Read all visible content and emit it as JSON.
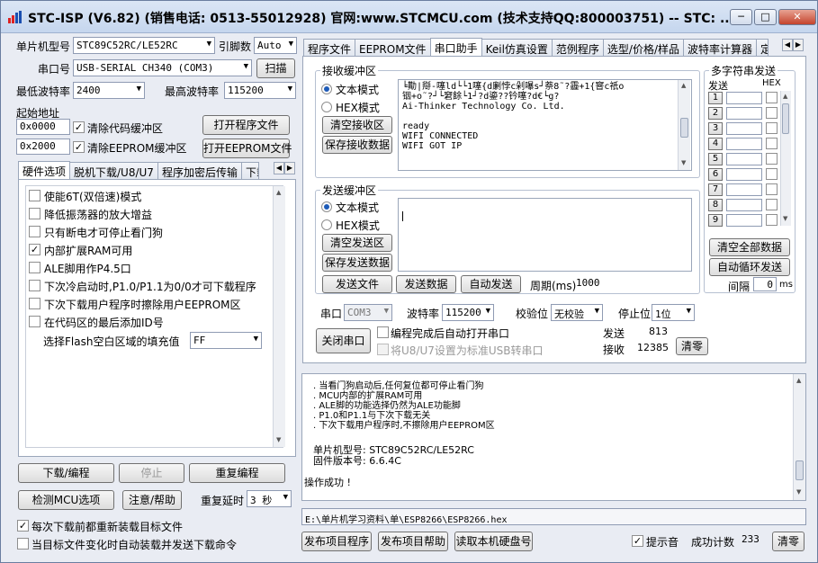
{
  "window": {
    "title": "STC-ISP (V6.82) (销售电话: 0513-55012928) 官网:www.STCMCU.com  (技术支持QQ:800003751)  -- STC: ...",
    "min_label": "─",
    "max_label": "□",
    "close_label": "✕"
  },
  "left": {
    "mcu_label": "单片机型号",
    "mcu_value": "STC89C52RC/LE52RC",
    "pin_label": "引脚数",
    "pin_value": "Auto",
    "port_label": "串口号",
    "port_value": "USB-SERIAL CH340 (COM3)",
    "scan_label": "扫描",
    "min_baud_label": "最低波特率",
    "min_baud_value": "2400",
    "max_baud_label": "最高波特率",
    "max_baud_value": "115200",
    "start_addr_label": "起始地址",
    "addr1": "0x0000",
    "clear_code_label": "清除代码缓冲区",
    "open_prog_label": "打开程序文件",
    "addr2": "0x2000",
    "clear_eeprom_label": "清除EEPROM缓冲区",
    "open_eeprom_label": "打开EEPROM文件",
    "tabs": [
      "硬件选项",
      "脱机下载/U8/U7",
      "程序加密后传输",
      "下载"
    ],
    "options": [
      {
        "label": "使能6T(双倍速)模式",
        "checked": false
      },
      {
        "label": "降低振荡器的放大增益",
        "checked": false
      },
      {
        "label": "只有断电才可停止看门狗",
        "checked": false
      },
      {
        "label": "内部扩展RAM可用",
        "checked": true
      },
      {
        "label": "ALE脚用作P4.5口",
        "checked": false
      },
      {
        "label": "下次冷启动时,P1.0/P1.1为0/0才可下载程序",
        "checked": false
      },
      {
        "label": "下次下载用户程序时擦除用户EEPROM区",
        "checked": false
      },
      {
        "label": "在代码区的最后添加ID号",
        "checked": false
      }
    ],
    "fill_label": "选择Flash空白区域的填充值",
    "fill_value": "FF",
    "download_label": "下载/编程",
    "stop_label": "停止",
    "reprogram_label": "重复编程",
    "detect_label": "检测MCU选项",
    "help_label": "注意/帮助",
    "delay_label": "重复延时",
    "delay_value": "3 秒",
    "reload_label": "每次下载前都重新装载目标文件",
    "reload_checked": true,
    "autoload_label": "当目标文件变化时自动装载并发送下载命令",
    "autoload_checked": false
  },
  "right": {
    "tabs": [
      "程序文件",
      "EEPROM文件",
      "串口助手",
      "Keil仿真设置",
      "范例程序",
      "选型/价格/样品",
      "波特率计算器",
      "定"
    ],
    "active_tab": "串口助手",
    "recv_group": "接收缓冲区",
    "text_mode": "文本模式",
    "hex_mode": "HEX模式",
    "clear_recv": "清空接收区",
    "save_recv": "保存接收数据",
    "recv_lines": [
      "╘勩|搿-噻ld└└1噻{d劆悖c剁嚗s┘萘8˜?霾+1{窨c祇o",
      "铟+o˜?┘└窘餘└1┘?d鎏??钤噻?d€└g?",
      "Ai-Thinker Technology Co. Ltd.",
      "",
      "ready",
      "WIFI CONNECTED",
      "WIFI GOT IP"
    ],
    "send_group": "发送缓冲区",
    "clear_send": "清空发送区",
    "save_send": "保存发送数据",
    "send_file": "发送文件",
    "send_data": "发送数据",
    "auto_send": "自动发送",
    "period_label": "周期(ms)",
    "period_value": "1000",
    "multi_group": "多字符串发送",
    "send_col": "发送",
    "hex_col": "HEX",
    "rows": [
      "1",
      "2",
      "3",
      "4",
      "5",
      "6",
      "7",
      "8",
      "9"
    ],
    "clear_all": "清空全部数据",
    "auto_loop": "自动循环发送",
    "interval_label": "间隔",
    "interval_value": "0",
    "interval_unit": "ms",
    "serial_label": "串口",
    "serial_value": "COM3",
    "baud_label": "波特率",
    "baud_value": "115200",
    "parity_label": "校验位",
    "parity_value": "无校验",
    "stop_label": "停止位",
    "stop_value": "1位",
    "close_port": "关闭串口",
    "auto_open": "编程完成后自动打开串口",
    "usb_convert": "将U8/U7设置为标准USB转串口",
    "sent_label": "发送",
    "sent_count": "813",
    "recv_label": "接收",
    "recv_count": "12385",
    "clear_counts": "清零"
  },
  "log": {
    "lines": [
      ". 当看门狗启动后,任何复位都可停止看门狗",
      ". MCU内部的扩展RAM可用",
      ". ALE脚的功能选择仍然为ALE功能脚",
      ". P1.0和P1.1与下次下载无关",
      ". 下次下载用户程序时,不擦除用户EEPROM区"
    ],
    "mcu_line": "单片机型号: STC89C52RC/LE52RC",
    "fw_line": "固件版本号: 6.6.4C",
    "success": "操作成功 !"
  },
  "bottom": {
    "path": "E:\\单片机学习资料\\单\\ESP8266\\ESP8266.hex",
    "publish_prog": "发布项目程序",
    "publish_help": "发布项目帮助",
    "read_disk": "读取本机硬盘号",
    "hint_label": "提示音",
    "hint_checked": true,
    "success_count_label": "成功计数",
    "success_count": "233",
    "clear_label": "清零"
  }
}
